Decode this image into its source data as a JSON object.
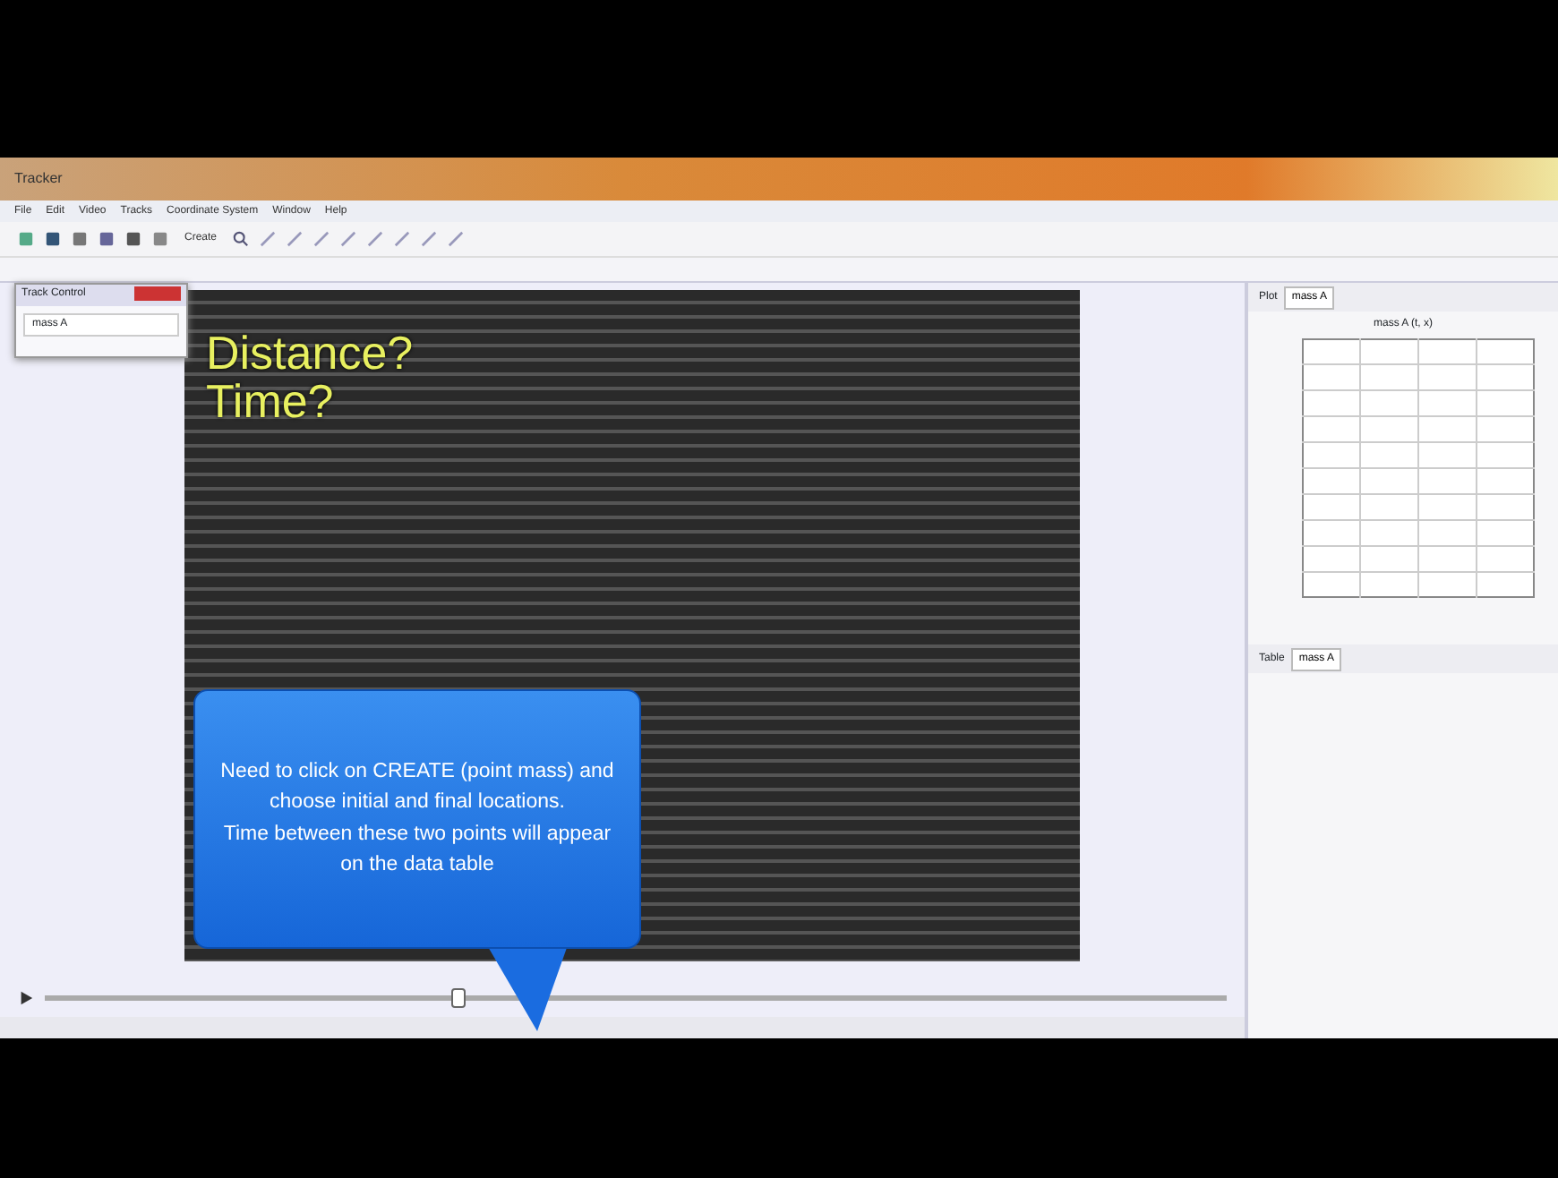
{
  "window": {
    "title": "Tracker"
  },
  "menu": [
    "File",
    "Edit",
    "Video",
    "Tracks",
    "Coordinate System",
    "Window",
    "Help"
  ],
  "toolbar": {
    "create_label": "Create"
  },
  "track_control": {
    "title": "Track Control",
    "items": [
      "mass A"
    ]
  },
  "video": {
    "overlay_lines": [
      "Distance?",
      "Time?"
    ]
  },
  "callout": {
    "paragraphs": [
      "Need to click on CREATE (point mass) and choose initial and final locations.",
      "Time between these two points will appear on the data table"
    ]
  },
  "plot_view": {
    "label": "Plot",
    "track": "mass A",
    "title": "mass A (t, x)"
  },
  "table_view": {
    "label": "Table",
    "track": "mass A"
  },
  "player": {
    "level": 0.35
  }
}
